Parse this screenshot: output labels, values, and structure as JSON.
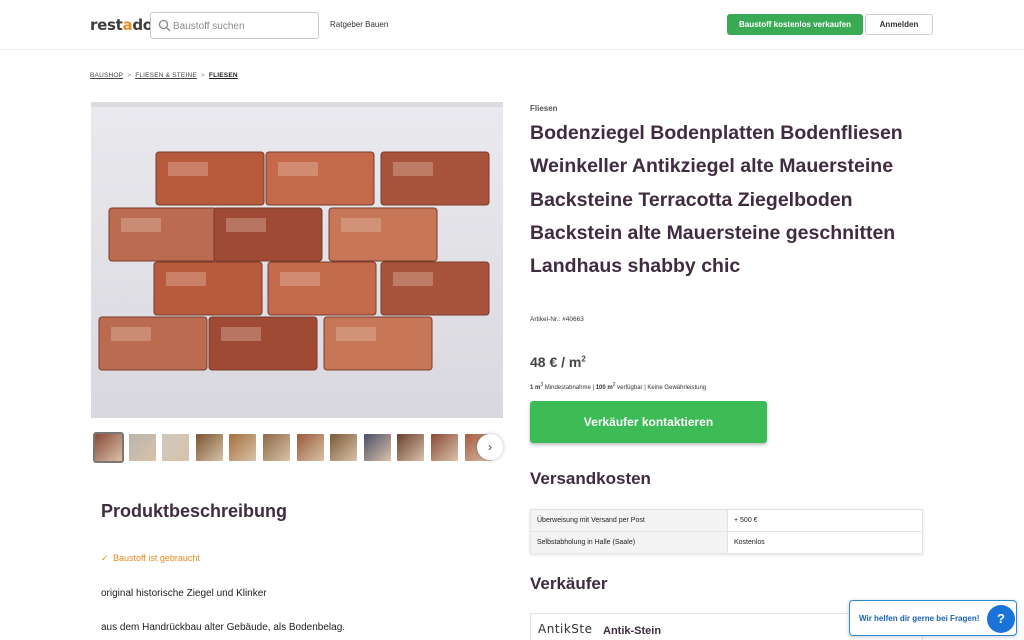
{
  "header": {
    "logo_text": "restado",
    "logo_prefix": "rest",
    "logo_accent": "a",
    "logo_suffix": "do",
    "search_placeholder": "Baustoff suchen",
    "nav_link": "Ratgeber Bauen",
    "sell_button": "Baustoff kostenlos verkaufen",
    "login_button": "Anmelden"
  },
  "breadcrumb": {
    "items": [
      "BAUSHOP",
      "FLIESEN & STEINE",
      "FLIESEN"
    ],
    "separator": ">"
  },
  "gallery": {
    "main_image_icon": "brick-floor-photo",
    "thumbnail_count": 12,
    "next_icon": "chevron-right-icon"
  },
  "product": {
    "category": "Fliesen",
    "title": "Bodenziegel Bodenplatten Bodenfliesen Weinkeller Antikziegel alte Mauersteine Backsteine Terracotta Ziegelboden Backstein alte Mauersteine geschnitten Landhaus shabby chic",
    "article_number": "Artikel-Nr.: #40663",
    "price_value": "48 € / m",
    "price_unit_sup": "2",
    "meta": {
      "min_qty": "1 m",
      "min_qty_sup": "3",
      "min_label": " Mindestabnahme | ",
      "available": "100 m",
      "available_sup": "2",
      "available_label": " verfügbar | Keine Gewährleistung"
    },
    "contact_button": "Verkäufer kontaktieren"
  },
  "shipping": {
    "title": "Versandkosten",
    "rows": [
      {
        "label": "Überweisung mit Versand per Post",
        "value": "+ 500 €"
      },
      {
        "label": "Selbstabholung in Halle (Saale)",
        "value": "Kostenlos"
      }
    ]
  },
  "seller": {
    "title": "Verkäufer",
    "logo_text": "AntikSte",
    "name": "Antik-Stein"
  },
  "description": {
    "title": "Produktbeschreibung",
    "used_badge": "Baustoff ist gebraucht",
    "paragraph_1": "original historische Ziegel und Klinker",
    "paragraph_2": "aus dem Handrückbau alter Gebäude, als Bodenbelag."
  },
  "help": {
    "text": "Wir helfen dir gerne bei Fragen!",
    "button": "?"
  },
  "colors": {
    "brand_orange": "#f28c28",
    "cta_green": "#3aaa55",
    "heading_purple": "#3f2d3f",
    "help_blue": "#1a73d9"
  }
}
